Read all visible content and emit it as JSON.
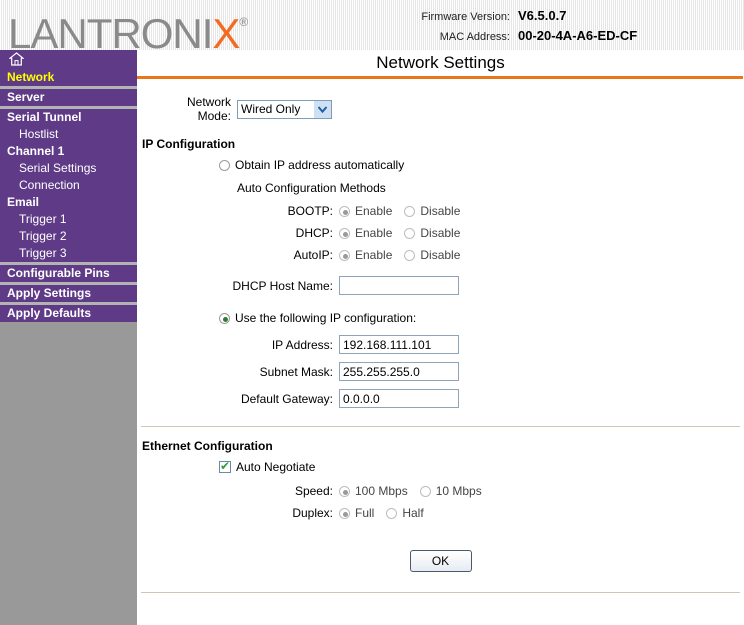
{
  "header": {
    "logo_text": "LANTRONI",
    "logo_accent": "X",
    "logo_reg": "®",
    "firmware_label": "Firmware Version:",
    "firmware_value": "V6.5.0.7",
    "mac_label": "MAC Address:",
    "mac_value": "00-20-4A-A6-ED-CF"
  },
  "sidebar": {
    "home_icon": "home-icon",
    "items": [
      {
        "label": "Network",
        "level": "main",
        "active": true
      },
      {
        "label": "Server",
        "level": "main",
        "active": false
      },
      {
        "label": "Serial Tunnel",
        "level": "main",
        "active": false
      },
      {
        "label": "Hostlist",
        "level": "sub",
        "active": false
      },
      {
        "label": "Channel 1",
        "level": "main",
        "active": false
      },
      {
        "label": "Serial Settings",
        "level": "sub",
        "active": false
      },
      {
        "label": "Connection",
        "level": "sub",
        "active": false
      },
      {
        "label": "Email",
        "level": "main",
        "active": false
      },
      {
        "label": "Trigger 1",
        "level": "sub",
        "active": false
      },
      {
        "label": "Trigger 2",
        "level": "sub",
        "active": false
      },
      {
        "label": "Trigger 3",
        "level": "sub",
        "active": false
      },
      {
        "label": "Configurable Pins",
        "level": "main",
        "active": false
      },
      {
        "label": "Apply Settings",
        "level": "main",
        "active": false
      },
      {
        "label": "Apply Defaults",
        "level": "main",
        "active": false
      }
    ]
  },
  "main": {
    "title": "Network Settings",
    "network_mode": {
      "label": "Network Mode:",
      "selected": "Wired Only",
      "options": [
        "Wired Only"
      ]
    },
    "ip_configuration": {
      "heading": "IP Configuration",
      "obtain_auto_label": "Obtain IP address automatically",
      "obtain_auto_selected": false,
      "auto_methods_label": "Auto Configuration Methods",
      "methods": [
        {
          "label": "BOOTP:",
          "enable_label": "Enable",
          "disable_label": "Disable",
          "value": "Enable"
        },
        {
          "label": "DHCP:",
          "enable_label": "Enable",
          "disable_label": "Disable",
          "value": "Enable"
        },
        {
          "label": "AutoIP:",
          "enable_label": "Enable",
          "disable_label": "Disable",
          "value": "Enable"
        }
      ],
      "dhcp_host_name_label": "DHCP Host Name:",
      "dhcp_host_name_value": "",
      "use_following_label": "Use the following IP configuration:",
      "use_following_selected": true,
      "fields": [
        {
          "label": "IP Address:",
          "value": "192.168.111.101"
        },
        {
          "label": "Subnet Mask:",
          "value": "255.255.255.0"
        },
        {
          "label": "Default Gateway:",
          "value": "0.0.0.0"
        }
      ]
    },
    "ethernet_configuration": {
      "heading": "Ethernet Configuration",
      "auto_negotiate_label": "Auto Negotiate",
      "auto_negotiate_checked": true,
      "speed_label": "Speed:",
      "speed_options": [
        "100 Mbps",
        "10 Mbps"
      ],
      "speed_value": "100 Mbps",
      "duplex_label": "Duplex:",
      "duplex_options": [
        "Full",
        "Half"
      ],
      "duplex_value": "Full"
    },
    "ok_button": "OK"
  },
  "colors": {
    "sidebar_purple": "#5E3A87",
    "sidebar_gray": "#999999",
    "accent_orange": "#E8761A",
    "logo_orange": "#F26B21",
    "active_yellow": "#FFFF00",
    "divider_tan": "#CFC7B3"
  }
}
